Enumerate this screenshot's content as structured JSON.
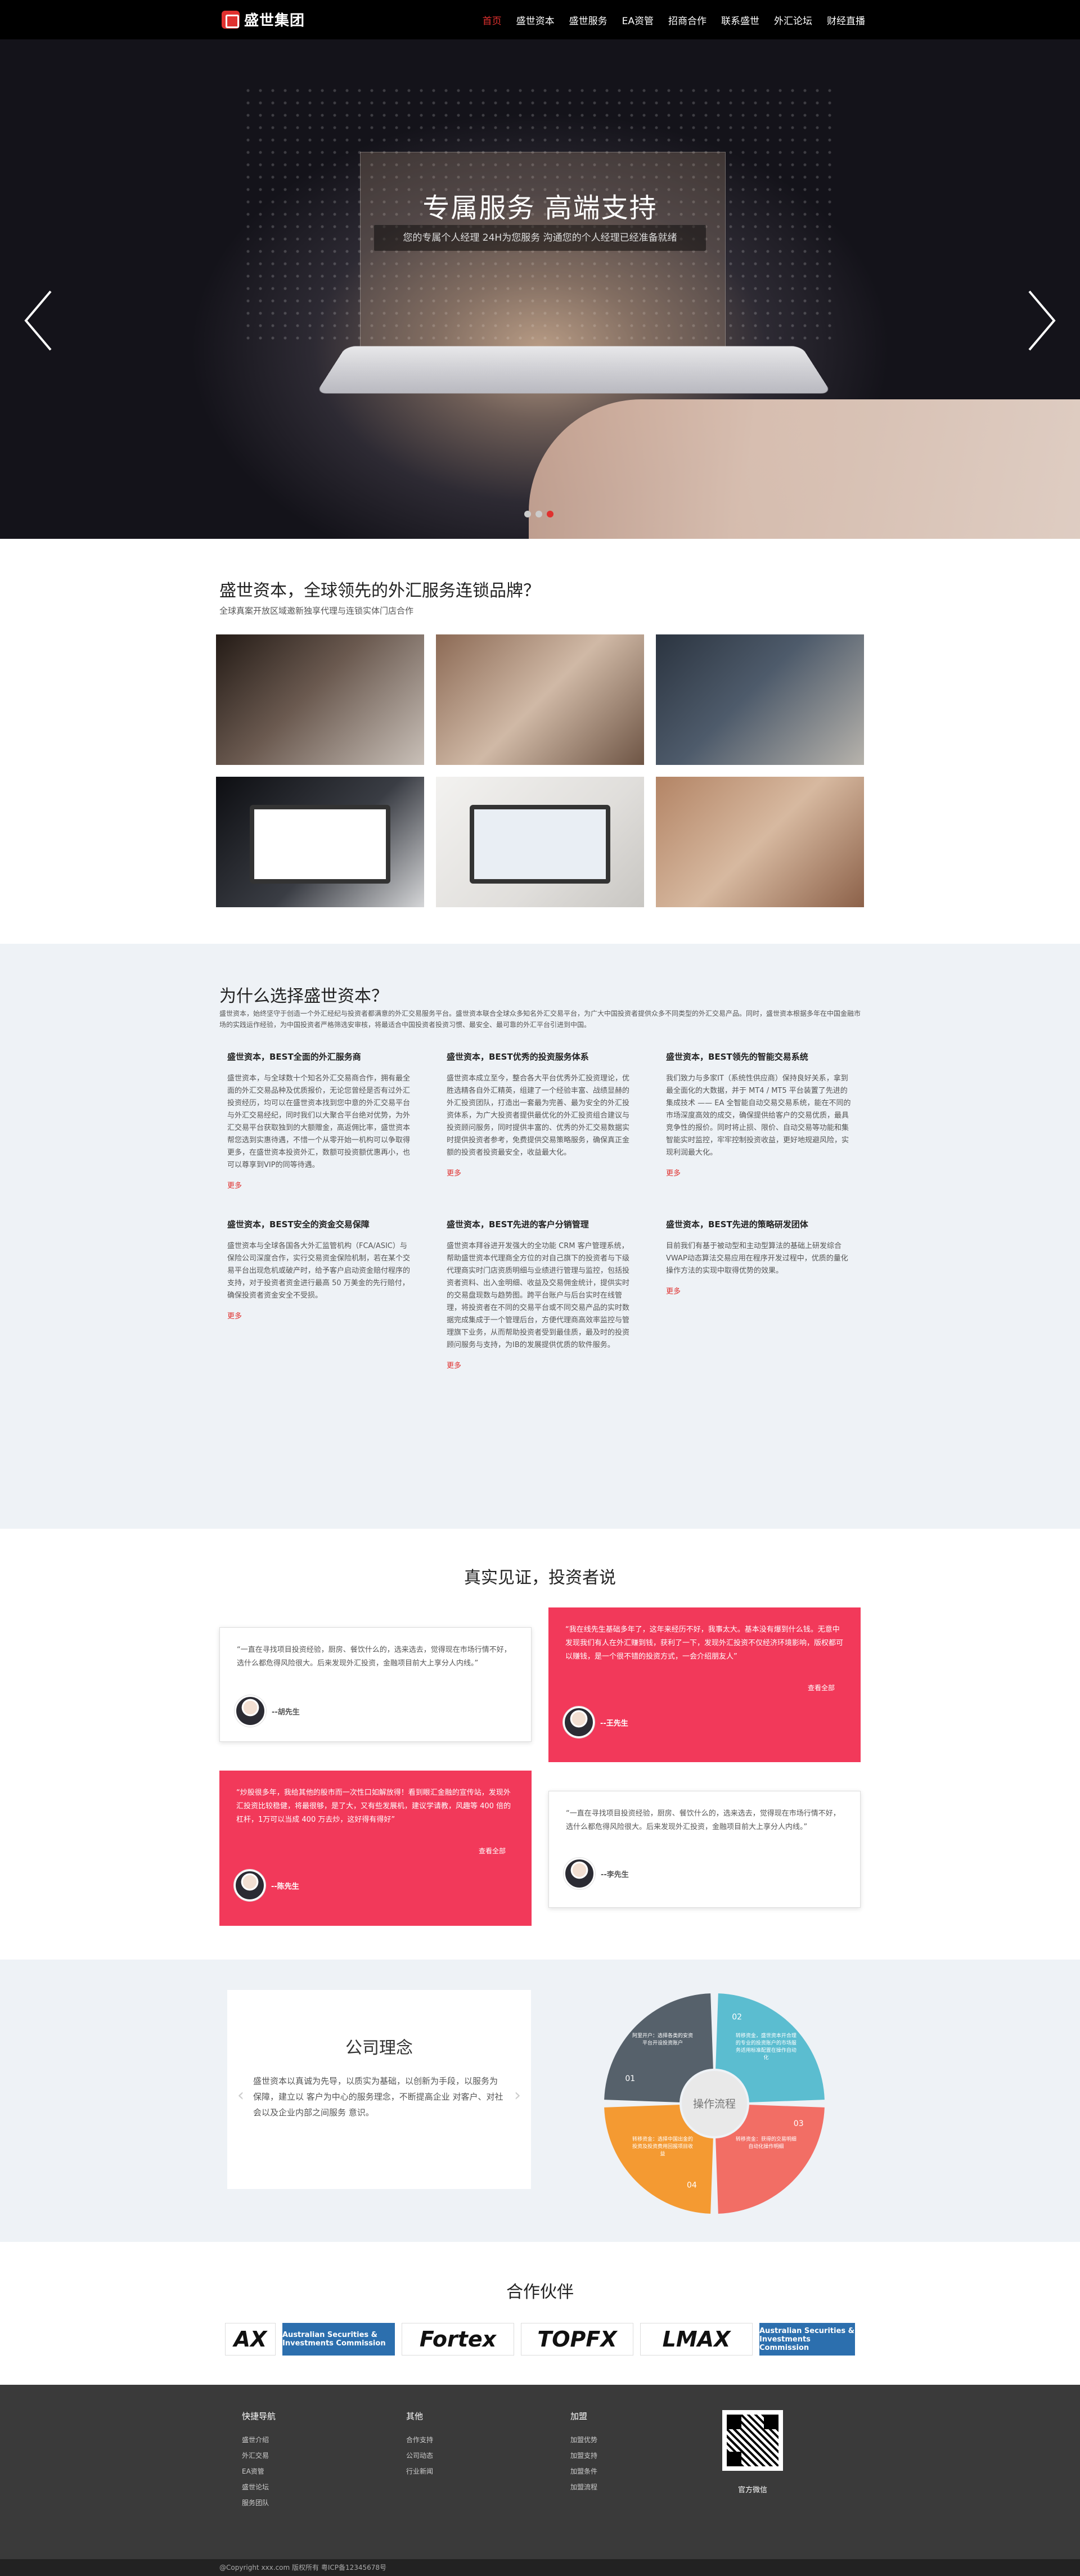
{
  "nav": {
    "logo": "盛世集团",
    "links": [
      "首页",
      "盛世资本",
      "盛世服务",
      "EA资管",
      "招商合作",
      "联系盛世",
      "外汇论坛",
      "财经直播"
    ]
  },
  "hero": {
    "title": "专属服务 高端支持",
    "subtitle": "您的专属个人经理 24H为您服务 沟通您的个人经理已经准备就绪",
    "slides": 3,
    "active_slide": 3
  },
  "brand": {
    "title": "盛世资本，全球领先的外汇服务连锁品牌？",
    "subtitle": "全球真案开放区域邀新独享代理与连锁实体门店合作"
  },
  "why": {
    "title": "为什么选择盛世资本？",
    "intro": "盛世资本，始终坚守于创造一个外汇经纪与投资者都满意的外汇交易服务平台。盛世资本联合全球众多知名外汇交易平台，为广大中国投资者提供众多不同类型的外汇交易产品。同时，盛世资本根据多年在中国金融市场的实践运作经验，为中国投资者严格筛选安审核，将最适合中国投资者投资习惯、最安全、最可靠的外汇平台引进到中国。",
    "more_label": "更多",
    "items": [
      {
        "title": "盛世资本，BEST全面的外汇服务商",
        "text": "盛世资本，与全球数十个知名外汇交易商合作，拥有最全面的外汇交易品种及优质报价，无论您曾经是否有过外汇投资经历，均可以在盛世资本找到您中意的外汇交易平台与外汇交易经纪，同时我们以大聚合平台绝对优势，为外汇交易平台获取独到的大额赠金，高返佣比率，盛世资本帮您选到实惠待遇，不惜一个从零开始一机构可以争取得更多，在盛世资本投资外汇，数额可投资额优惠再小，也可以尊享到VIP的同等待遇。"
      },
      {
        "title": "盛世资本，BEST优秀的投资服务体系",
        "text": "盛世资本成立至今，整合各大平台优秀外汇投资理论，优胜选精各自外汇精英，组建了一个经验丰富、战绩显赫的外汇投资团队，打造出一套最为完善、最为安全的外汇投资体系，为广大投资者提供最优化的外汇投资组合建议与投资顾问服务，同时提供丰富的、优秀的外汇交易数据实时提供投资者参考，免费提供交易策略服务，确保真正金额的投资者投资最安全，收益最大化。"
      },
      {
        "title": "盛世资本，BEST领先的智能交易系统",
        "text": "我们致力与多家IT（系统性供应商）保持良好关系，拿到最全面化的大数据，并于 MT4 / MT5 平台装置了先进的集成技术 —— EA 全智能自动交易交易系统，能在不同的市场深度高效的成交，确保提供给客户的交易优质，最具竞争性的报价。同时将止损、限价、自动交易等功能和集智能实时监控，牢牢控制投资收益，更好地规避风险，实现利润最大化。"
      },
      {
        "title": "盛世资本，BEST安全的资金交易保障",
        "text": "盛世资本与全球各国各大外汇监管机构（FCA/ASIC）与保险公司深度合作，实行交易资金保险机制，若在某个交易平台出现危机或破产时，给予客户启动资金赔付程序的支持，对于投资者资金进行最高 50 万美金的先行赔付，确保投资者资金安全不受损。"
      },
      {
        "title": "盛世资本，BEST先进的客户分销管理",
        "text": "盛世资本拜谷进开发强大的全功能 CRM 客户管理系统，帮助盛世资本代理商全方位的对自己旗下的投资者与下级代理商实时门店资质明细与业绩进行管理与监控，包括投资者资料、出入金明细、收益及交易佣金统计，提供实时的交易盘现数与趋势图。跨平台账户与后台实时在线管理，将投资者在不同的交易平台或不同交易产品的实时数据完成集成于一个管理后台，方便代理商高效率监控与管理旗下业务，从而帮助投资者受到最佳质，最及时的投资顾问服务与支持，为IB的发展提供优质的软件服务。"
      },
      {
        "title": "盛世资本，BEST先进的策略研发团体",
        "text": "目前我们有基于被动型和主动型算法的基础上研发综合VWAP动态算法交易应用在程序开发过程中，优质的量化操作方法的实现中取得优势的效果。"
      }
    ]
  },
  "testimonials": {
    "title": "真实见证，投资者说",
    "source_label": "查看全部",
    "items": [
      {
        "text": "“一直在寻找项目投资经验，厨房、餐饮什么的，选来选去，觉得现在市场行情不好，选什么都危得风险很大。后来发现外汇投资，金融项目前大上享分人内线。”",
        "name": "--胡先生",
        "style": "white"
      },
      {
        "text": "“我在线先生基础多年了，这年来经历不好，我事太大。基本没有爆到什么钱。无意中发现我们有人在外汇赚到钱，获利了一下，发现外汇投资不仅经济环境影响，版权都可以赚钱，是一个很不错的投资方式，一会介绍朋友人”",
        "name": "--王先生",
        "style": "red"
      },
      {
        "text": "“炒股很多年，我给其他的股市而一次性口如解放得！看到眼汇金融的宣传站，发现外汇投资比较稳健，将最很够，是了大，又有些发展机，建议学请教，风趣等 400 倍的杠杆，1万可以当成 400 万去炒，这好得有得好”",
        "name": "--陈先生",
        "style": "red"
      },
      {
        "text": "“一直在寻找项目投资经验，厨房、餐饮什么的，选来选去，觉得现在市场行情不好，选什么都危得风险很大。后来发现外汇投资，金融项目前大上享分人内线。”",
        "name": "--李先生",
        "style": "white"
      }
    ]
  },
  "concept": {
    "title": "公司理念",
    "text": "盛世资本以真诚为先导，以质实为基础，以创新为手段，以服务为保障，建立以 客户为中心的服务理念，不断提高企业 对客户、对社会以及企业内部之间服务 意识。",
    "wheel_center": "操作流程",
    "segments": [
      {
        "num": "01",
        "text": "阿里开户：选择各类的安资平台开设投资账户",
        "color": "#56616b"
      },
      {
        "num": "02",
        "text": "转移资金，盛世资本开合理的专业的投资账户的市场服务适用标准配置在操作自动化",
        "color": "#5bbdd0"
      },
      {
        "num": "03",
        "text": "转移资金：获得的交易明细自动化操作明细",
        "color": "#f26e65"
      },
      {
        "num": "04",
        "text": "转移资金：选择中国出金的投资及投资费用回报项目收益",
        "color": "#f49a32"
      }
    ]
  },
  "partners": {
    "title": "合作伙伴",
    "logos": [
      "AX",
      "Australian Securities & Investments Commission",
      "Fortex",
      "TOPFX",
      "LMAX",
      "Australian Securities & Investments Commission"
    ]
  },
  "footer": {
    "cols": [
      {
        "title": "快捷导航",
        "items": [
          "盛世介绍",
          "外汇交易",
          "EA资管",
          "盛世论坛",
          "服务团队"
        ]
      },
      {
        "title": "其他",
        "items": [
          "合作支持",
          "公司动态",
          "行业新闻"
        ]
      },
      {
        "title": "加盟",
        "items": [
          "加盟优势",
          "加盟支持",
          "加盟条件",
          "加盟流程"
        ]
      }
    ],
    "qr_label": "官方微信",
    "copyright": "@Copyright xxx.com 版权所有 粤ICP备12345678号"
  }
}
